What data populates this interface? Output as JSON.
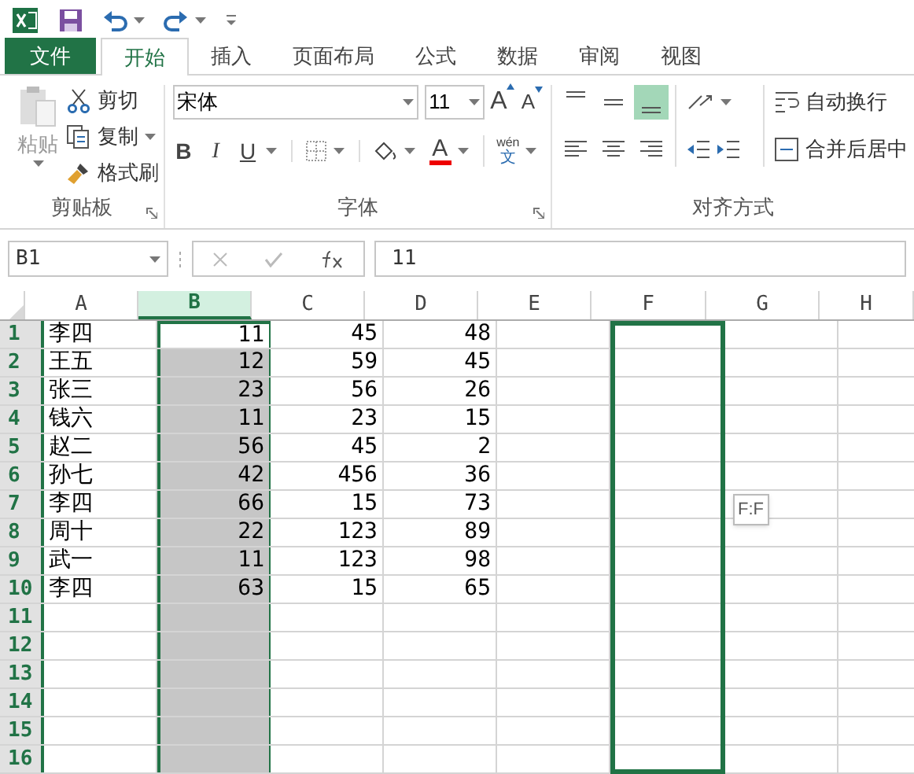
{
  "ribbon_tabs": [
    {
      "label": "文件",
      "kind": "file",
      "selected": false
    },
    {
      "label": "开始",
      "kind": "tab",
      "selected": true
    },
    {
      "label": "插入",
      "kind": "tab",
      "selected": false
    },
    {
      "label": "页面布局",
      "kind": "tab",
      "selected": false
    },
    {
      "label": "公式",
      "kind": "tab",
      "selected": false
    },
    {
      "label": "数据",
      "kind": "tab",
      "selected": false
    },
    {
      "label": "审阅",
      "kind": "tab",
      "selected": false
    },
    {
      "label": "视图",
      "kind": "tab",
      "selected": false
    }
  ],
  "clipboard": {
    "paste": "粘贴",
    "cut": "剪切",
    "copy": "复制",
    "format_painter": "格式刷",
    "group_label": "剪贴板"
  },
  "font": {
    "font_name": "宋体",
    "font_size": "11",
    "grow": "A",
    "shrink": "A",
    "bold": "B",
    "italic": "I",
    "underline": "U",
    "font_color": "A",
    "phonetic_top": "wén",
    "phonetic_bottom": "文",
    "group_label": "字体"
  },
  "alignment": {
    "vertical": [
      {
        "kind": "top",
        "selected": false
      },
      {
        "kind": "middle",
        "selected": false
      },
      {
        "kind": "bottom",
        "selected": true
      }
    ],
    "wrap_text": "自动换行",
    "merge_center": "合并后居中",
    "group_label": "对齐方式"
  },
  "formula_bar": {
    "name_box": "B1",
    "formula": "11"
  },
  "sheet": {
    "columns": [
      {
        "label": "A",
        "selected": false,
        "outlined": false
      },
      {
        "label": "B",
        "selected": true,
        "outlined": false
      },
      {
        "label": "C",
        "selected": false,
        "outlined": false
      },
      {
        "label": "D",
        "selected": false,
        "outlined": false
      },
      {
        "label": "E",
        "selected": false,
        "outlined": false
      },
      {
        "label": "F",
        "selected": false,
        "outlined": true
      },
      {
        "label": "G",
        "selected": false,
        "outlined": false
      },
      {
        "label": "H",
        "selected": false,
        "outlined": false
      }
    ],
    "rows": [
      {
        "header": "1",
        "values": [
          "李四",
          "11",
          "45",
          "48"
        ],
        "active": true
      },
      {
        "header": "2",
        "values": [
          "王五",
          "12",
          "59",
          "45"
        ],
        "active": false
      },
      {
        "header": "3",
        "values": [
          "张三",
          "23",
          "56",
          "26"
        ],
        "active": false
      },
      {
        "header": "4",
        "values": [
          "钱六",
          "11",
          "23",
          "15"
        ],
        "active": false
      },
      {
        "header": "5",
        "values": [
          "赵二",
          "56",
          "45",
          "2"
        ],
        "active": false
      },
      {
        "header": "6",
        "values": [
          "孙七",
          "42",
          "456",
          "36"
        ],
        "active": false
      },
      {
        "header": "7",
        "values": [
          "李四",
          "66",
          "15",
          "73"
        ],
        "active": false
      },
      {
        "header": "8",
        "values": [
          "周十",
          "22",
          "123",
          "89"
        ],
        "active": false
      },
      {
        "header": "9",
        "values": [
          "武一",
          "11",
          "123",
          "98"
        ],
        "active": false
      },
      {
        "header": "10",
        "values": [
          "李四",
          "63",
          "15",
          "65"
        ],
        "active": false
      },
      {
        "header": "11",
        "active": false
      },
      {
        "header": "12",
        "active": false
      },
      {
        "header": "13",
        "active": false
      },
      {
        "header": "14",
        "active": false
      },
      {
        "header": "15",
        "active": false
      },
      {
        "header": "16",
        "active": false
      }
    ],
    "tooltip": "F:F"
  }
}
